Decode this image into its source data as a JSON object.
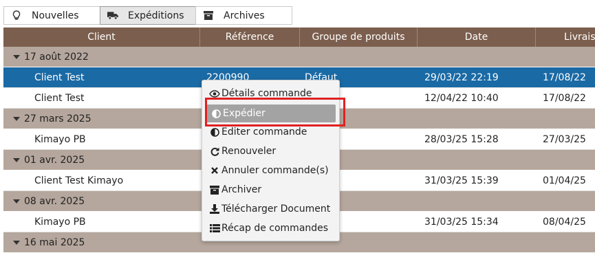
{
  "tabs": [
    {
      "label": "Nouvelles",
      "icon": "lightbulb-icon",
      "active": false
    },
    {
      "label": "Expéditions",
      "icon": "truck-icon",
      "active": true
    },
    {
      "label": "Archives",
      "icon": "archive-icon",
      "active": false
    }
  ],
  "table": {
    "columns": [
      "Client",
      "Référence",
      "Groupe de produits",
      "Date",
      "Livraiso"
    ],
    "groups": [
      {
        "label": "17 août 2022",
        "rows": [
          {
            "client": "Client Test",
            "reference": "2200990",
            "groupe": "Défaut",
            "date": "29/03/22 22:19",
            "livraison": "17/08/22",
            "selected": true
          },
          {
            "client": "Client Test",
            "reference": "",
            "groupe": "",
            "date": "12/04/22 10:40",
            "livraison": "17/08/22",
            "selected": false
          }
        ]
      },
      {
        "label": "27 mars 2025",
        "rows": [
          {
            "client": "Kimayo PB",
            "reference": "",
            "groupe": "",
            "date": "28/03/25 15:28",
            "livraison": "27/03/25",
            "selected": false
          }
        ]
      },
      {
        "label": "01 avr. 2025",
        "rows": [
          {
            "client": "Client Test Kimayo",
            "reference": "",
            "groupe": "",
            "date": "31/03/25 15:39",
            "livraison": "01/04/25",
            "selected": false
          }
        ]
      },
      {
        "label": "08 avr. 2025",
        "rows": [
          {
            "client": "Kimayo PB",
            "reference": "",
            "groupe": "",
            "date": "31/03/25 15:34",
            "livraison": "08/04/25",
            "selected": false
          }
        ]
      },
      {
        "label": "16 mai 2025",
        "rows": []
      }
    ]
  },
  "context_menu": {
    "items": [
      {
        "label": "Détails commande",
        "icon": "eye-icon"
      },
      {
        "label": "Expédier",
        "icon": "half-circle-icon",
        "highlighted": true
      },
      {
        "label": "Editer commande",
        "icon": "half-circle-icon"
      },
      {
        "label": "Renouveler",
        "icon": "refresh-icon"
      },
      {
        "label": "Annuler commande(s)",
        "icon": "close-icon"
      },
      {
        "label": "Archiver",
        "icon": "archive-icon"
      },
      {
        "label": "Télécharger Document",
        "icon": "download-icon"
      },
      {
        "label": "Récap de commandes",
        "icon": "list-icon"
      }
    ]
  },
  "colors": {
    "header": "#7b5e4d",
    "group_row": "#b5a79d",
    "selected_row": "#1a6aa5",
    "highlight_border": "#e02020"
  }
}
